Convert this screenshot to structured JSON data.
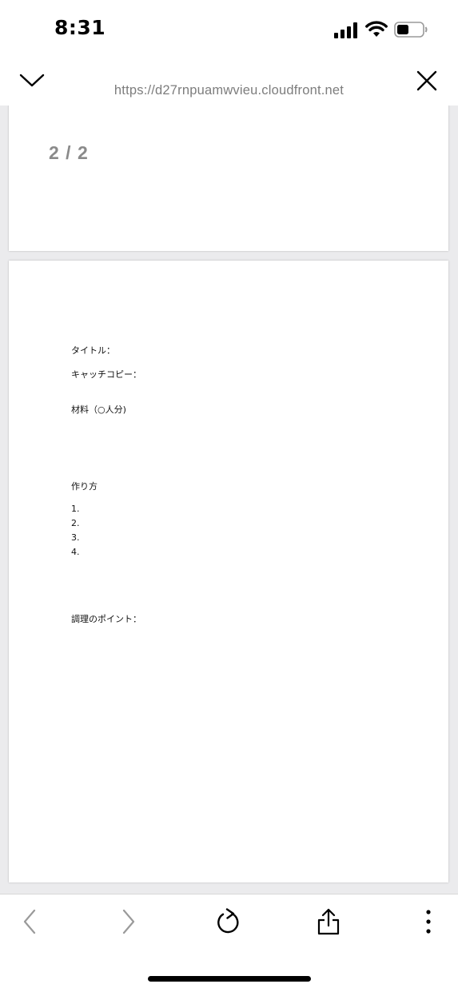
{
  "status_bar": {
    "time": "8:31"
  },
  "browser": {
    "url": "https://d27rnpuamwvieu.cloudfront.net",
    "collapse_icon": "chevron-down-icon",
    "close_icon": "close-icon"
  },
  "viewer": {
    "page_indicator": "2 / 2"
  },
  "document": {
    "title_label": "タイトル：",
    "catchcopy_label": "キャッチコピー：",
    "ingredients_label": "材料（○人分)",
    "method_label": "作り方",
    "steps": [
      "1.",
      "2.",
      "3.",
      "4."
    ],
    "tips_label": "調理のポイント："
  },
  "toolbar": {
    "back_icon": "chevron-left-icon",
    "forward_icon": "chevron-right-icon",
    "reload_icon": "reload-icon",
    "share_icon": "share-icon",
    "more_icon": "more-vertical-icon"
  },
  "colors": {
    "url_text": "#7d7d7d",
    "page_indicator": "#8a8a8a",
    "viewer_background": "#ebebed",
    "disabled_icon": "#9a9a9a"
  }
}
